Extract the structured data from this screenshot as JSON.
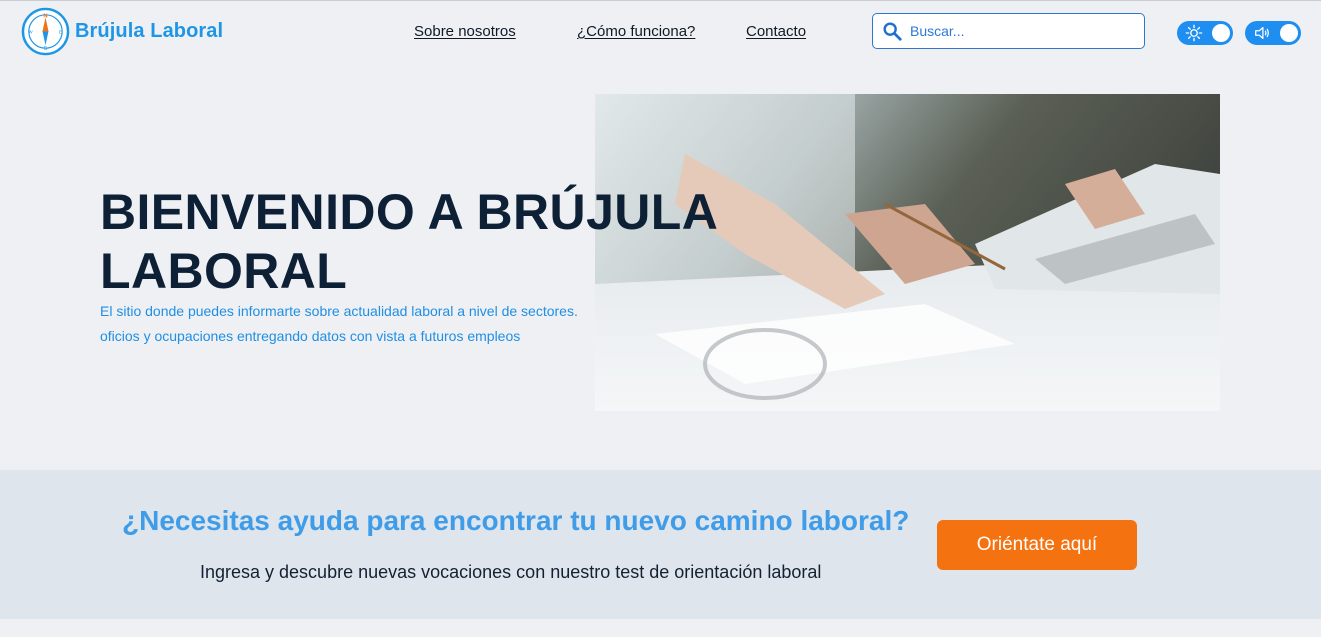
{
  "brand": {
    "name": "Brújula Laboral",
    "logo_icon": "compass-icon",
    "color": "#1e96e6"
  },
  "nav": {
    "about": "Sobre nosotros",
    "how": "¿Cómo funciona?",
    "contact": "Contacto"
  },
  "search": {
    "placeholder": "Buscar...",
    "value": "",
    "icon": "search-icon"
  },
  "toggles": {
    "theme": {
      "icon": "sun-icon",
      "state": "on"
    },
    "sound": {
      "icon": "speaker-icon",
      "state": "on"
    }
  },
  "hero": {
    "title": "BIENVENIDO A BRÚJULA LABORAL",
    "subtitle": "El sitio donde puedes informarte sobre actualidad laboral a nivel de sectores. oficios y ocupaciones entregando datos con vista a futuros empleos",
    "image_icon": "office-meeting-photo"
  },
  "cta": {
    "heading": "¿Necesitas ayuda para encontrar tu nuevo camino laboral?",
    "text": "Ingresa y descubre nuevas vocaciones con nuestro test de orientación laboral",
    "button": "Oriéntate aquí",
    "button_color": "#f57210"
  },
  "colors": {
    "accent": "#1e8ef0",
    "title": "#0e2036",
    "band": "#dfe5ec",
    "background": "#eef0f3"
  }
}
